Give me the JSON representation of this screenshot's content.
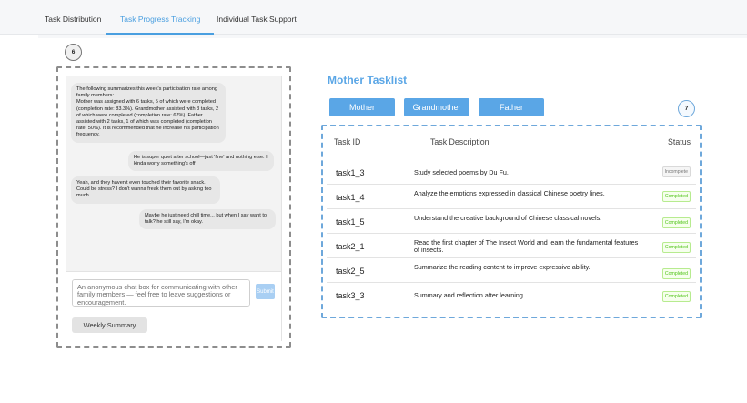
{
  "tabs": [
    {
      "label": "Task Distribution",
      "active": false
    },
    {
      "label": "Task Progress Tracking",
      "active": true
    },
    {
      "label": "Individual Task Support",
      "active": false
    }
  ],
  "steps": {
    "chat": "6",
    "tasks": "7"
  },
  "chat": {
    "messages": [
      {
        "side": "left",
        "text": "The following summarizes this week's participation rate among family members:\nMother was assigned with 6 tasks, 5 of which were completed (completion rate: 83.3%). Grandmother assisted with 3 tasks, 2 of which were completed (completion rate: 67%). Father assisted with 2 tasks, 1 of which was completed (completion rate: 50%). It is recommended that he increase his participation frequency."
      },
      {
        "side": "right",
        "text": "He is super quiet after school—just 'fine' and nothing else. I kinda worry something's off"
      },
      {
        "side": "left",
        "text": "Yeah, and they haven't even touched their favorite snack. Could be stress? I don't wanna freak them out by asking too much."
      },
      {
        "side": "right",
        "text": "Maybe he just need chill time... but when I say want to talk? he still say, I'm okay."
      }
    ],
    "input_placeholder": "An anonymous chat box for communicating with other family members — feel free to leave suggestions or encouragement.",
    "submit_label": "Submit",
    "weekly_summary_label": "Weekly Summary"
  },
  "tasklist": {
    "title": "Mother Tasklist",
    "members": [
      "Mother",
      "Grandmother",
      "Father"
    ],
    "columns": {
      "id": "Task ID",
      "description": "Task Description",
      "status": "Status"
    },
    "rows": [
      {
        "id": "task1_3",
        "description": "Study selected poems by Du Fu.",
        "status": "Incomplete"
      },
      {
        "id": "task1_4",
        "description": "Analyze the emotions expressed in classical Chinese poetry lines.",
        "status": "Completed"
      },
      {
        "id": "task1_5",
        "description": "Understand the creative background of Chinese classical novels.",
        "status": "Completed"
      },
      {
        "id": "task2_1",
        "description": "Read the first chapter of The Insect World and learn the fundamental features of insects.",
        "status": "Completed"
      },
      {
        "id": "task2_5",
        "description": "Summarize the reading content to improve expressive ability.",
        "status": "Completed"
      },
      {
        "id": "task3_3",
        "description": "Summary and reflection after learning.",
        "status": "Completed"
      }
    ]
  },
  "colors": {
    "accent": "#5aa6e6",
    "completed": "#52c41a",
    "incomplete": "#777777"
  }
}
